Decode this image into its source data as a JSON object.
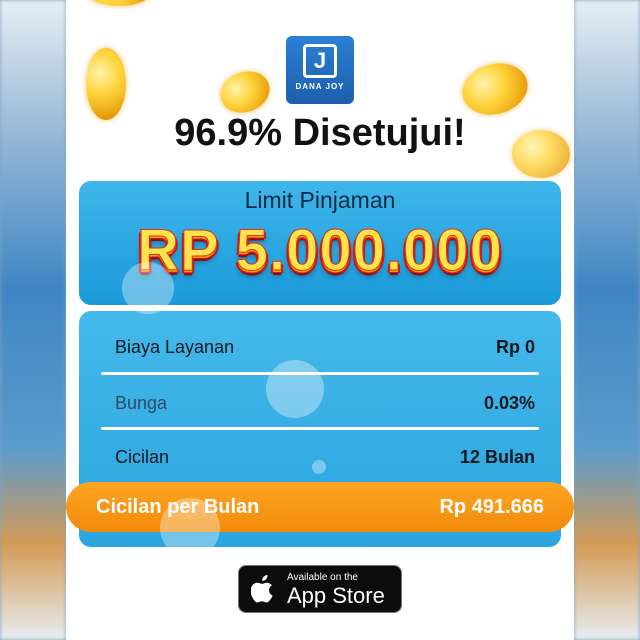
{
  "logo": {
    "brand": "DANA JOY",
    "mark": "J"
  },
  "headline": "96.9% Disetujui!",
  "limit": {
    "title": "Limit Pinjaman",
    "amount": "RP 5.000.000"
  },
  "details": [
    {
      "label": "Biaya Layanan",
      "value": "Rp 0"
    },
    {
      "label": "Bunga",
      "value": "0.03%"
    },
    {
      "label": "Cicilan",
      "value": "12 Bulan"
    }
  ],
  "monthly": {
    "label": "Cicilan per Bulan",
    "value": "Rp 491.666"
  },
  "appstore": {
    "small": "Available on the",
    "big": "App Store"
  },
  "colors": {
    "accent_orange": "#f7941d",
    "card_blue": "#2aa4de",
    "gold": "#ffd23a"
  }
}
